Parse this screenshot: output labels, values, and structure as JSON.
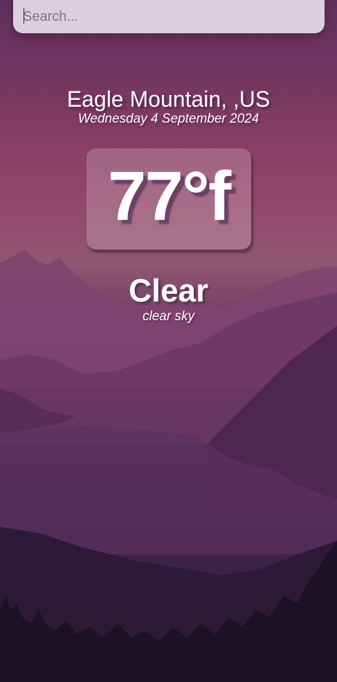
{
  "search": {
    "placeholder": "Search...",
    "value": ""
  },
  "location": {
    "name": "Eagle Mountain, ,US",
    "date": "Wednesday 4 September 2024"
  },
  "current": {
    "temperature": "77°f",
    "condition": "Clear",
    "description": "clear sky"
  },
  "theme": {
    "text_color": "#ffffff",
    "search_bg": "#dbcfdd",
    "sky_top": "#5f2e5e",
    "horizon": "#93486a",
    "ground_dark": "#1a1226"
  }
}
